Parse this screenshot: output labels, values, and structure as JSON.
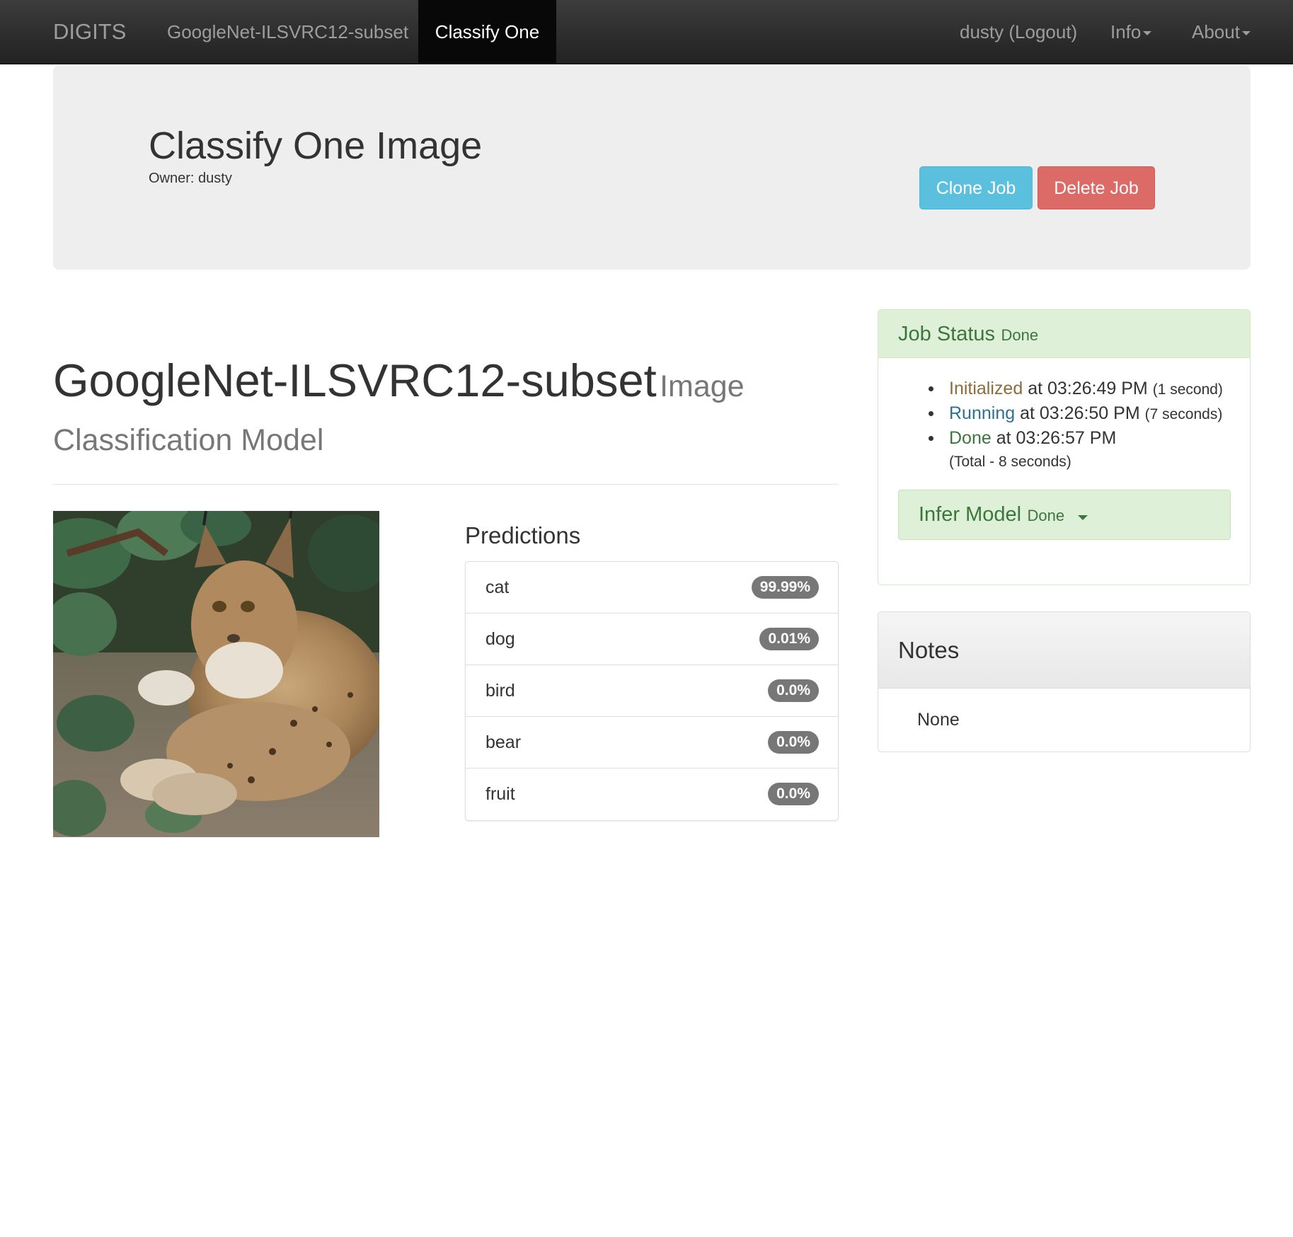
{
  "navbar": {
    "brand": "DIGITS",
    "model_link": "GoogleNet-ILSVRC12-subset",
    "active_tab": "Classify One",
    "user": "dusty (Logout)",
    "info": "Info",
    "about": "About"
  },
  "jumbotron": {
    "title": "Classify One Image",
    "owner": "Owner: dusty",
    "clone_label": "Clone Job",
    "delete_label": "Delete Job"
  },
  "model": {
    "name": "GoogleNet-ILSVRC12-subset",
    "subtitle_part1": "Image",
    "subtitle_part2": "Classification Model"
  },
  "predictions": {
    "heading": "Predictions",
    "items": [
      {
        "label": "cat",
        "value": "99.99%"
      },
      {
        "label": "dog",
        "value": "0.01%"
      },
      {
        "label": "bird",
        "value": "0.0%"
      },
      {
        "label": "bear",
        "value": "0.0%"
      },
      {
        "label": "fruit",
        "value": "0.0%"
      }
    ]
  },
  "job_status": {
    "title": "Job Status",
    "state": "Done",
    "events": [
      {
        "status": "Initialized",
        "time": "at 03:26:49 PM",
        "duration": "(1 second)"
      },
      {
        "status": "Running",
        "time": "at 03:26:50 PM",
        "duration": "(7 seconds)"
      },
      {
        "status": "Done",
        "time": "at 03:26:57 PM",
        "duration": ""
      }
    ],
    "total": "(Total - 8 seconds)",
    "infer_title": "Infer Model",
    "infer_state": "Done"
  },
  "notes": {
    "title": "Notes",
    "body": "None"
  },
  "colors": {
    "navbar": "#222222",
    "info_button": "#5bc0de",
    "danger_button": "#d9534f",
    "success_text": "#3c763d",
    "success_bg": "#dff0d8",
    "warning_text": "#8a6d3b",
    "info_text": "#31708f",
    "badge": "#777777"
  }
}
